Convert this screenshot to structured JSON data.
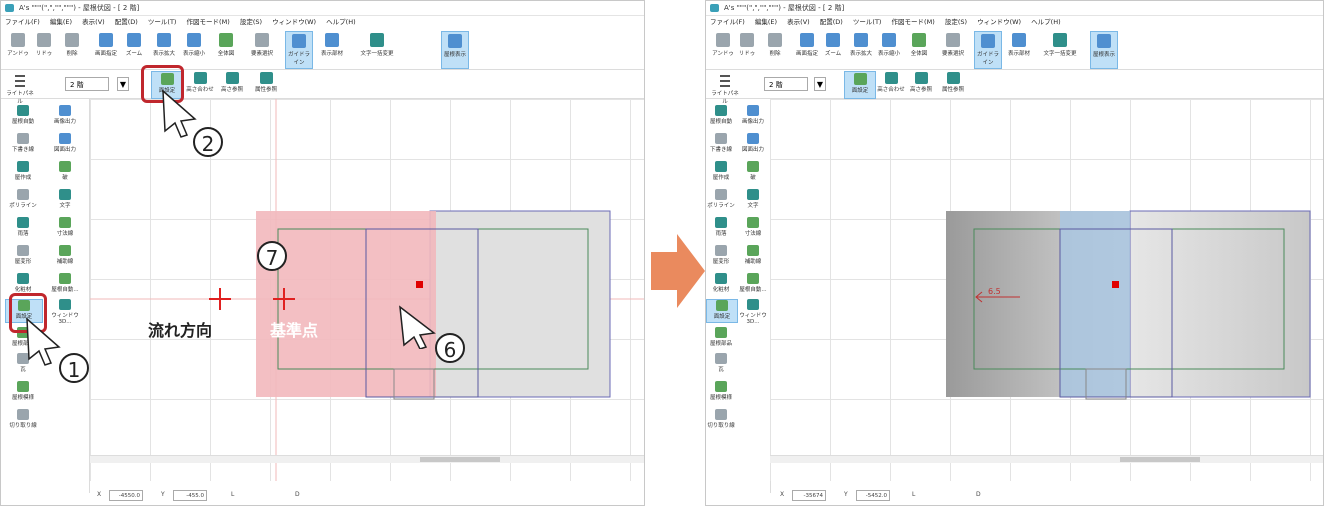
{
  "left": {
    "title": "A's \"\"\"(\",\",\"\",\"\"\") - 屋根伏図 - [ 2 階]",
    "menu": [
      "ファイル(F)",
      "編集(E)",
      "表示(V)",
      "配置(D)",
      "ツール(T)",
      "作図モード(M)",
      "設定(S)",
      "ウィンドウ(W)",
      "ヘルプ(H)"
    ],
    "toolbar": [
      "アンドゥ",
      "リドゥ",
      "削除",
      "画面指定",
      "ズーム",
      "表示拡大",
      "表示縮小",
      "全体図",
      "要素選択",
      "ガイドライン",
      "表示部材",
      "文字一括変更",
      "屋根表示"
    ],
    "hamburger": "ライトパネル",
    "floor": "2 階",
    "sub": [
      "面設定",
      "高さ合わせ",
      "高さ参照",
      "属性参照"
    ],
    "sidebar": [
      "屋根自動",
      "画像出力",
      "下書き線",
      "図面出力",
      "屋作成",
      "破",
      "ポリライン",
      "文字",
      "雨落",
      "寸法線",
      "屋変形",
      "補助線",
      "化粧材",
      "屋根自動...",
      "面設定",
      "ウィンドウ3D...",
      "屋根部品",
      "瓦",
      "屋根模様",
      "切り取り線"
    ],
    "canvas": {
      "label_flow": "流れ方向",
      "label_base": "基準点"
    },
    "badges": [
      "1",
      "2",
      "6",
      "7"
    ],
    "status": {
      "x_label": "X",
      "x_value": "-4550.0",
      "y_label": "Y",
      "y_value": "-455.0",
      "l_label": "L",
      "d_label": "D"
    }
  },
  "right": {
    "title": "A's \"\"\"(\",\",\"\",\"\"\") - 屋根伏図 - [ 2 階]",
    "menu": [
      "ファイル(F)",
      "編集(E)",
      "表示(V)",
      "配置(D)",
      "ツール(T)",
      "作図モード(M)",
      "設定(S)",
      "ウィンドウ(W)",
      "ヘルプ(H)"
    ],
    "toolbar": [
      "アンドゥ",
      "リドゥ",
      "削除",
      "画面指定",
      "ズーム",
      "表示拡大",
      "表示縮小",
      "全体図",
      "要素選択",
      "ガイドライン",
      "表示部材",
      "文字一括変更",
      "屋根表示"
    ],
    "hamburger": "ライトパネル",
    "floor": "2 階",
    "sub": [
      "面設定",
      "高さ合わせ",
      "高さ参照",
      "属性参照"
    ],
    "sidebar": [
      "屋根自動",
      "画像出力",
      "下書き線",
      "図面出力",
      "屋作成",
      "破",
      "ポリライン",
      "文字",
      "雨落",
      "寸法線",
      "屋変形",
      "補助線",
      "化粧材",
      "屋根自動...",
      "面設定",
      "ウィンドウ3D...",
      "屋根部品",
      "瓦",
      "屋根模様",
      "切り取り線"
    ],
    "canvas": {
      "slope": "6.5"
    },
    "status": {
      "x_label": "X",
      "x_value": "-35674",
      "y_label": "Y",
      "y_value": "-5452.0",
      "l_label": "L",
      "d_label": "D"
    }
  },
  "colors": {
    "highlight": "#c0272d",
    "arrow": "#ea8a5e",
    "pink_fill": "#f2b8bd",
    "blue_fill": "#a9c6e0",
    "gray_fill": "#9a9a9a"
  }
}
